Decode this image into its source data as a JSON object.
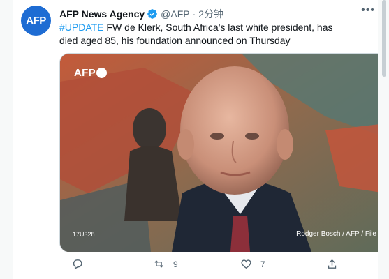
{
  "tweet": {
    "avatar_text": "AFP",
    "name": "AFP News Agency",
    "handle": "@AFP",
    "separator": "·",
    "time": "2分钟",
    "hashtag": "#UPDATE",
    "body": " FW de Klerk, South Africa's last white president, has died aged 85, his foundation announced on Thursday",
    "media": {
      "logo_text": "AFP",
      "code": "17U328",
      "credit": "Rodger Bosch / AFP / File"
    },
    "actions": {
      "reply_count": "",
      "retweet_count": "9",
      "like_count": "7"
    }
  },
  "colors": {
    "brand_blue": "#1e6cd3",
    "link_blue": "#1d9bf0",
    "muted": "#536471"
  },
  "icons": [
    "verified-badge-icon",
    "more-icon",
    "reply-icon",
    "retweet-icon",
    "like-icon",
    "share-icon"
  ]
}
